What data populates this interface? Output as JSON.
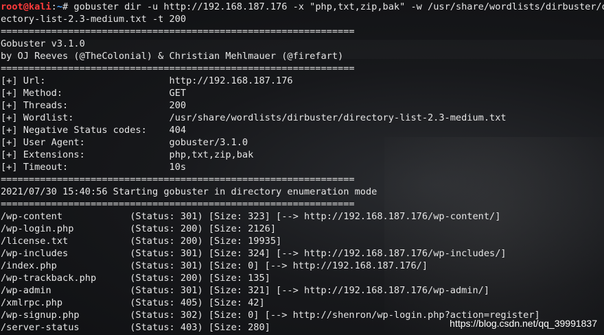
{
  "prompt": {
    "user_host": "root@kali",
    "path": "~",
    "symbol": "# ",
    "command_line1": "gobuster dir -u http://192.168.187.176 -x \"php,txt,zip,bak\" -w /usr/share/wordlists/dirbuster/dir",
    "command_line2": "ectory-list-2.3-medium.txt -t 200"
  },
  "separator": "===============================================================",
  "banner": {
    "title": "Gobuster v3.1.0",
    "authors": "by OJ Reeves (@TheColonial) & Christian Mehlmauer (@firefart)"
  },
  "config": [
    {
      "key": "[+] Url:",
      "value": "http://192.168.187.176"
    },
    {
      "key": "[+] Method:",
      "value": "GET"
    },
    {
      "key": "[+] Threads:",
      "value": "200"
    },
    {
      "key": "[+] Wordlist:",
      "value": "/usr/share/wordlists/dirbuster/directory-list-2.3-medium.txt"
    },
    {
      "key": "[+] Negative Status codes:",
      "value": "404"
    },
    {
      "key": "[+] User Agent:",
      "value": "gobuster/3.1.0"
    },
    {
      "key": "[+] Extensions:",
      "value": "php,txt,zip,bak"
    },
    {
      "key": "[+] Timeout:",
      "value": "10s"
    }
  ],
  "start_message": "2021/07/30 15:40:56 Starting gobuster in directory enumeration mode",
  "results": [
    {
      "path": "/wp-content",
      "status": "(Status: 301)",
      "size": "[Size: 323]",
      "redirect": "[--> http://192.168.187.176/wp-content/]"
    },
    {
      "path": "/wp-login.php",
      "status": "(Status: 200)",
      "size": "[Size: 2126]",
      "redirect": ""
    },
    {
      "path": "/license.txt",
      "status": "(Status: 200)",
      "size": "[Size: 19935]",
      "redirect": ""
    },
    {
      "path": "/wp-includes",
      "status": "(Status: 301)",
      "size": "[Size: 324]",
      "redirect": "[--> http://192.168.187.176/wp-includes/]"
    },
    {
      "path": "/index.php",
      "status": "(Status: 301)",
      "size": "[Size: 0]",
      "redirect": "[--> http://192.168.187.176/]"
    },
    {
      "path": "/wp-trackback.php",
      "status": "(Status: 200)",
      "size": "[Size: 135]",
      "redirect": ""
    },
    {
      "path": "/wp-admin",
      "status": "(Status: 301)",
      "size": "[Size: 321]",
      "redirect": "[--> http://192.168.187.176/wp-admin/]"
    },
    {
      "path": "/xmlrpc.php",
      "status": "(Status: 405)",
      "size": "[Size: 42]",
      "redirect": ""
    },
    {
      "path": "/wp-signup.php",
      "status": "(Status: 302)",
      "size": "[Size: 0]",
      "redirect": "[--> http://shenron/wp-login.php?action=register]"
    },
    {
      "path": "/server-status",
      "status": "(Status: 403)",
      "size": "[Size: 280]",
      "redirect": ""
    }
  ],
  "watermark": "https://blog.csdn.net/qq_39991837",
  "colors": {
    "user": "#ff3b3b",
    "path": "#4aa3ff",
    "text": "#e6e6e6"
  }
}
